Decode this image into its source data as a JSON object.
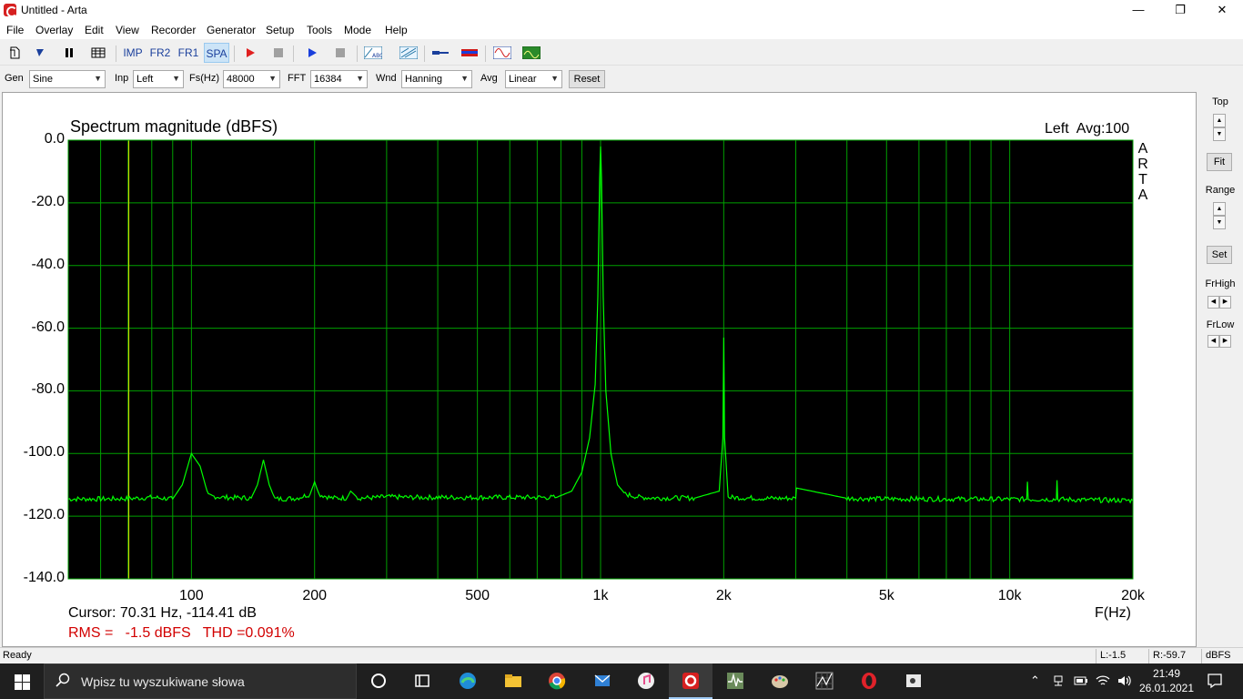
{
  "window": {
    "title": "Untitled - Arta",
    "minimize": "—",
    "maximize": "❐",
    "close": "✕"
  },
  "menu": [
    "File",
    "Overlay",
    "Edit",
    "View",
    "Recorder",
    "Generator",
    "Setup",
    "Tools",
    "Mode",
    "Help"
  ],
  "toolbar": {
    "imp": "IMP",
    "fr2": "FR2",
    "fr1": "FR1",
    "spa": "SPA"
  },
  "controls": {
    "gen_label": "Gen",
    "gen_value": "Sine",
    "inp_label": "Inp",
    "inp_value": "Left",
    "fs_label": "Fs(Hz)",
    "fs_value": "48000",
    "fft_label": "FFT",
    "fft_value": "16384",
    "wnd_label": "Wnd",
    "wnd_value": "Hanning",
    "avg_label": "Avg",
    "avg_value": "Linear",
    "reset": "Reset"
  },
  "plot": {
    "title": "Spectrum magnitude (dBFS)",
    "status": "Left  Avg:100",
    "brand_vertical": "ARTA",
    "cursor_readout": "Cursor: 70.31 Hz, -114.41 dB",
    "rms_readout": "RMS =   -1.5 dBFS   THD =0.091%",
    "x_unit": "F(Hz)"
  },
  "colors": {
    "plot_background": "#000000",
    "grid": "#00a000",
    "trace": "#00ff00",
    "cursor": "#e0e000",
    "rms_text": "#d20000"
  },
  "chart_data": {
    "type": "line",
    "title": "Spectrum magnitude (dBFS)",
    "xlabel": "F(Hz)",
    "ylabel": "",
    "x_scale": "log",
    "xlim": [
      50,
      20000
    ],
    "ylim": [
      -140,
      0
    ],
    "grid": true,
    "y_ticks": [
      "0.0",
      "-20.0",
      "-40.0",
      "-60.0",
      "-80.0",
      "-100.0",
      "-120.0",
      "-140.0"
    ],
    "y_tick_values": [
      0,
      -20,
      -40,
      -60,
      -80,
      -100,
      -120,
      -140
    ],
    "x_ticks": [
      "100",
      "200",
      "500",
      "1k",
      "2k",
      "5k",
      "10k",
      "20k"
    ],
    "x_tick_values": [
      100,
      200,
      500,
      1000,
      2000,
      5000,
      10000,
      20000
    ],
    "cursor_x": 70.31,
    "series": [
      {
        "x": [
          50,
          60,
          70,
          80,
          90,
          95,
          100,
          105,
          110,
          120,
          140,
          145,
          150,
          155,
          160,
          180,
          195,
          200,
          205,
          220,
          240,
          245,
          255,
          280,
          300,
          340,
          400,
          500,
          600,
          700,
          780,
          850,
          900,
          940,
          970,
          985,
          995,
          1000,
          1005,
          1015,
          1030,
          1060,
          1100,
          1150,
          1250,
          1400,
          1700,
          1950,
          1990,
          2000,
          2010,
          2050,
          2500,
          3000,
          3010,
          4000,
          5000,
          7000,
          10000,
          11000,
          11050,
          11100,
          12500,
          13000,
          13050,
          13100,
          15000,
          18000,
          20000
        ],
        "y": [
          -114.5,
          -114.5,
          -114.4,
          -114,
          -114.5,
          -110,
          -100,
          -104,
          -113.5,
          -114,
          -114.2,
          -110,
          -102,
          -110,
          -114.5,
          -114.3,
          -113,
          -109,
          -113,
          -114.2,
          -114.2,
          -112,
          -114.2,
          -114.1,
          -113.8,
          -114,
          -114,
          -114,
          -114,
          -114,
          -114,
          -112,
          -106,
          -95,
          -78,
          -50,
          -12,
          -2,
          -12,
          -50,
          -80,
          -100,
          -110,
          -113,
          -114,
          -114.2,
          -114.2,
          -112,
          -95,
          -63,
          -95,
          -114,
          -114.3,
          -114.3,
          -111,
          -114.3,
          -114.5,
          -114.5,
          -114.6,
          -114.6,
          -109,
          -114.6,
          -114.6,
          -114.6,
          -108.5,
          -114.6,
          -114.8,
          -114.9,
          -115
        ]
      }
    ]
  },
  "right_panel": {
    "top_label": "Top",
    "fit": "Fit",
    "range_label": "Range",
    "set": "Set",
    "frhigh_label": "FrHigh",
    "frlow_label": "FrLow"
  },
  "statusbar": {
    "text": "Ready",
    "left_level": "L:-1.5",
    "right_level": "R:-59.7",
    "unit": "dBFS"
  },
  "taskbar": {
    "search_placeholder": "Wpisz tu wyszukiwane słowa",
    "time": "21:49",
    "date": "26.01.2021"
  }
}
